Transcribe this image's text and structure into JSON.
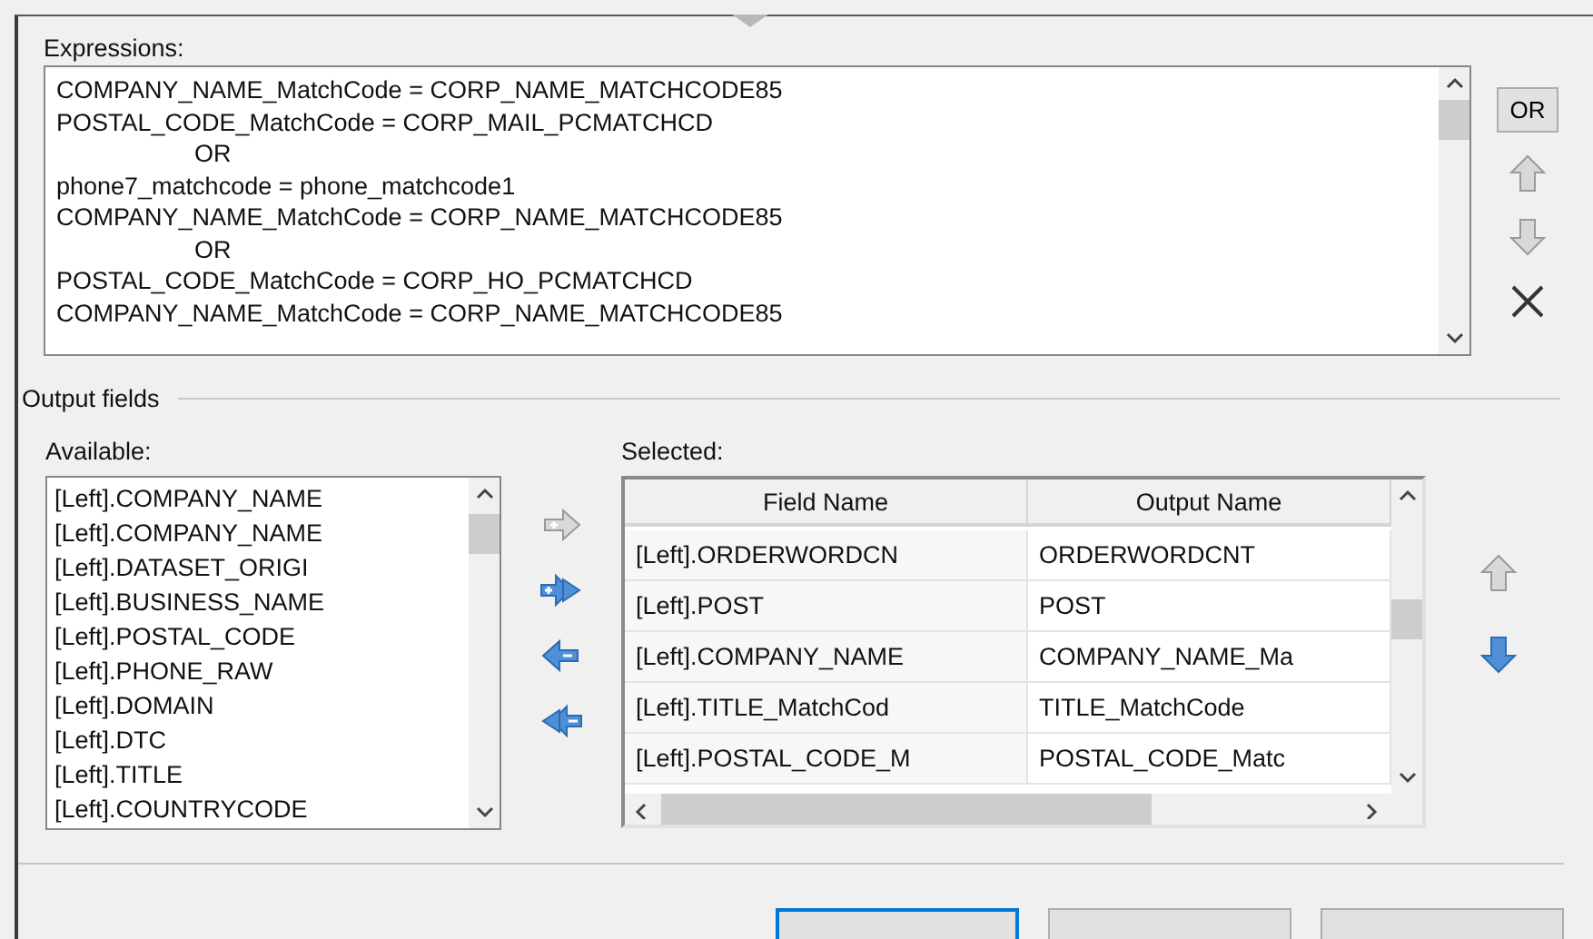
{
  "expressions": {
    "label": "Expressions:",
    "lines": [
      {
        "kind": "condition",
        "text": "COMPANY_NAME_MatchCode = CORP_NAME_MATCHCODE85"
      },
      {
        "kind": "condition",
        "text": "POSTAL_CODE_MatchCode = CORP_MAIL_PCMATCHCD"
      },
      {
        "kind": "operator",
        "text": "OR"
      },
      {
        "kind": "condition",
        "text": "phone7_matchcode = phone_matchcode1"
      },
      {
        "kind": "condition",
        "text": "COMPANY_NAME_MatchCode = CORP_NAME_MATCHCODE85"
      },
      {
        "kind": "operator",
        "text": "OR"
      },
      {
        "kind": "condition",
        "text": "POSTAL_CODE_MatchCode = CORP_HO_PCMATCHCD"
      },
      {
        "kind": "condition",
        "text": "COMPANY_NAME_MatchCode = CORP_NAME_MATCHCODE85"
      }
    ],
    "buttons": [
      {
        "kind": "text",
        "label": "OR",
        "disabled": false
      },
      {
        "kind": "up",
        "disabled": true
      },
      {
        "kind": "down",
        "disabled": true
      },
      {
        "kind": "delete",
        "disabled": false
      }
    ]
  },
  "output_fields": {
    "title": "Output fields",
    "available": {
      "label": "Available:",
      "items": [
        "[Left].COMPANY_NAME",
        "[Left].COMPANY_NAME",
        "[Left].DATASET_ORIGI",
        "[Left].BUSINESS_NAME",
        "[Left].POSTAL_CODE",
        "[Left].PHONE_RAW",
        "[Left].DOMAIN",
        "[Left].DTC",
        "[Left].TITLE",
        "[Left].COUNTRYCODE"
      ]
    },
    "transfer_buttons": [
      {
        "kind": "add",
        "disabled": true
      },
      {
        "kind": "add_all",
        "disabled": false
      },
      {
        "kind": "remove",
        "disabled": false
      },
      {
        "kind": "remove_all",
        "disabled": false
      }
    ],
    "selected": {
      "label": "Selected:",
      "columns": [
        "Field Name",
        "Output Name"
      ],
      "rows": [
        [
          "[Left].ORDERWORDCN",
          "ORDERWORDCNT"
        ],
        [
          "[Left].POST",
          "POST"
        ],
        [
          "[Left].COMPANY_NAME",
          "COMPANY_NAME_Ma"
        ],
        [
          "[Left].TITLE_MatchCod",
          "TITLE_MatchCode"
        ],
        [
          "[Left].POSTAL_CODE_M",
          "POSTAL_CODE_Matc"
        ]
      ]
    },
    "order_buttons": [
      {
        "kind": "up",
        "disabled": true
      },
      {
        "kind": "down",
        "disabled": false
      }
    ]
  },
  "dialog_buttons": [
    {
      "default": true
    },
    {
      "default": false
    },
    {
      "default": false
    }
  ]
}
